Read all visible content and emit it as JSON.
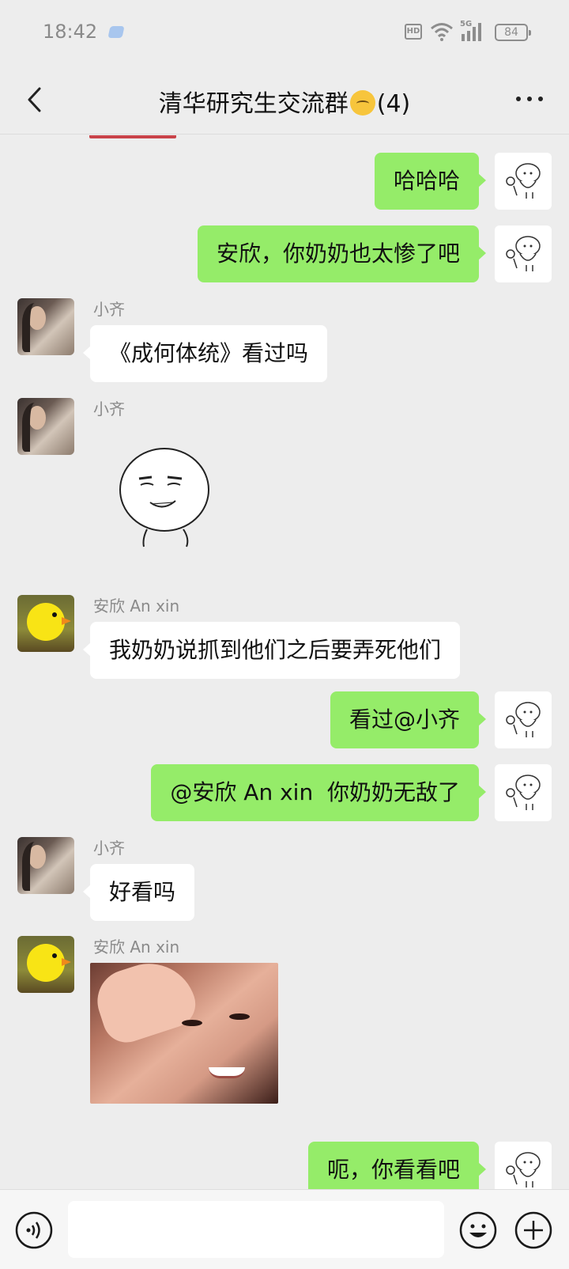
{
  "status_bar": {
    "time": "18:42",
    "hd": "HD",
    "network": "5G",
    "battery": "84"
  },
  "header": {
    "title": "清华研究生交流群",
    "member_count": "(4)",
    "back_icon": "chevron-left-icon",
    "more_icon": "more-dots-icon"
  },
  "colors": {
    "background": "#ededed",
    "self_bubble": "#95ec69",
    "other_bubble": "#ffffff",
    "sender_name": "#8a8a8a"
  },
  "messages": [
    {
      "side": "right",
      "type": "text",
      "text": "哈哈哈"
    },
    {
      "side": "right",
      "type": "text",
      "text": "安欣，你奶奶也太惨了吧"
    },
    {
      "side": "left",
      "sender": "小齐",
      "type": "text",
      "text": "《成何体统》看过吗"
    },
    {
      "side": "left",
      "sender": "小齐",
      "type": "sticker",
      "sticker": "smirking-face-sticker"
    },
    {
      "side": "left",
      "sender": "安欣 An xin",
      "type": "text",
      "text": "我奶奶说抓到他们之后要弄死他们"
    },
    {
      "side": "right",
      "type": "text",
      "text": "看过@小齐"
    },
    {
      "side": "right",
      "type": "text",
      "text": "@安欣 An xin  你奶奶无敌了"
    },
    {
      "side": "left",
      "sender": "小齐",
      "type": "text",
      "text": "好看吗"
    },
    {
      "side": "left",
      "sender": "安欣 An xin",
      "type": "image",
      "image": "man-hand-on-forehead-photo"
    },
    {
      "side": "right",
      "type": "text",
      "text": "呃，你看看吧"
    }
  ],
  "input_bar": {
    "voice_icon": "voice-icon",
    "input_value": "",
    "emoji_icon": "emoji-icon",
    "plus_icon": "plus-icon"
  }
}
